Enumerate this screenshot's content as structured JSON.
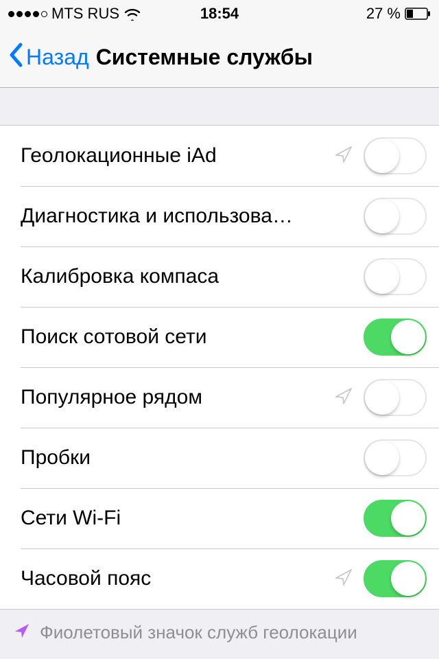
{
  "status": {
    "carrier": "MTS RUS",
    "time": "18:54",
    "battery_pct": "27 %"
  },
  "nav": {
    "back": "Назад",
    "title": "Системные службы"
  },
  "rows": [
    {
      "label": "Геолокационные iAd",
      "arrow": true,
      "on": false
    },
    {
      "label": "Диагностика и использова…",
      "arrow": false,
      "on": false
    },
    {
      "label": "Калибровка компаса",
      "arrow": false,
      "on": false
    },
    {
      "label": "Поиск сотовой сети",
      "arrow": false,
      "on": true
    },
    {
      "label": "Популярное рядом",
      "arrow": true,
      "on": false
    },
    {
      "label": "Пробки",
      "arrow": false,
      "on": false
    },
    {
      "label": "Сети Wi-Fi",
      "arrow": false,
      "on": true
    },
    {
      "label": "Часовой пояс",
      "arrow": true,
      "on": true
    }
  ],
  "footer": {
    "text": "Фиолетовый значок служб геолокации"
  }
}
